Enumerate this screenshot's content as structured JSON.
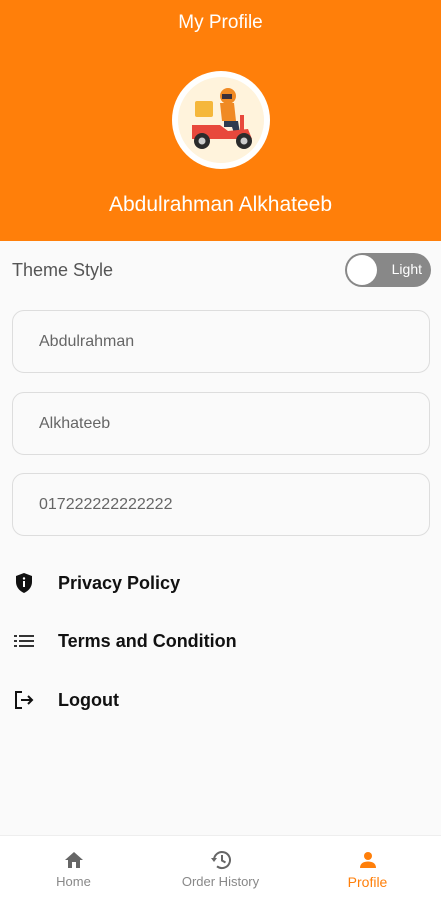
{
  "header": {
    "title": "My Profile",
    "user_name": "Abdulrahman Alkhateeb"
  },
  "theme": {
    "label": "Theme Style",
    "toggle_text": "Light"
  },
  "fields": {
    "first_name": "Abdulrahman",
    "last_name": "Alkhateeb",
    "phone": "017222222222222"
  },
  "menu": {
    "privacy": "Privacy Policy",
    "terms": "Terms and Condition",
    "logout": "Logout"
  },
  "nav": {
    "home": "Home",
    "history": "Order History",
    "profile": "Profile"
  },
  "colors": {
    "accent": "#ff7f0a",
    "inactive": "#888888"
  },
  "icons": {
    "privacy": "shield-icon",
    "terms": "list-icon",
    "logout": "logout-icon",
    "home": "home-icon",
    "history": "history-icon",
    "profile": "person-icon"
  }
}
